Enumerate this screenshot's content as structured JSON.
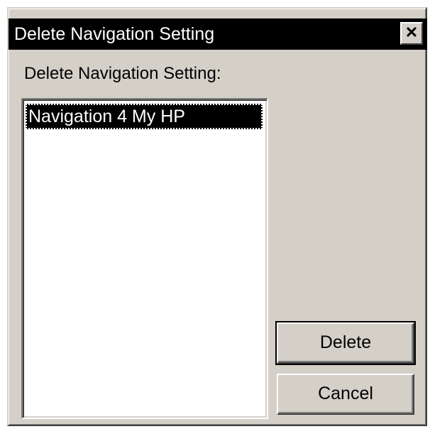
{
  "dialog": {
    "title": "Delete Navigation Setting",
    "close_symbol": "✕",
    "prompt_label": "Delete Navigation Setting:",
    "list": {
      "items": [
        "Navigation 4 My HP"
      ],
      "selected_index": 0
    },
    "buttons": {
      "delete_label": "Delete",
      "cancel_label": "Cancel"
    }
  },
  "colors": {
    "face": "#d4d0c8",
    "titlebar": "#000000",
    "title_text": "#ffffff",
    "list_bg": "#ffffff",
    "selection": "#000000"
  }
}
